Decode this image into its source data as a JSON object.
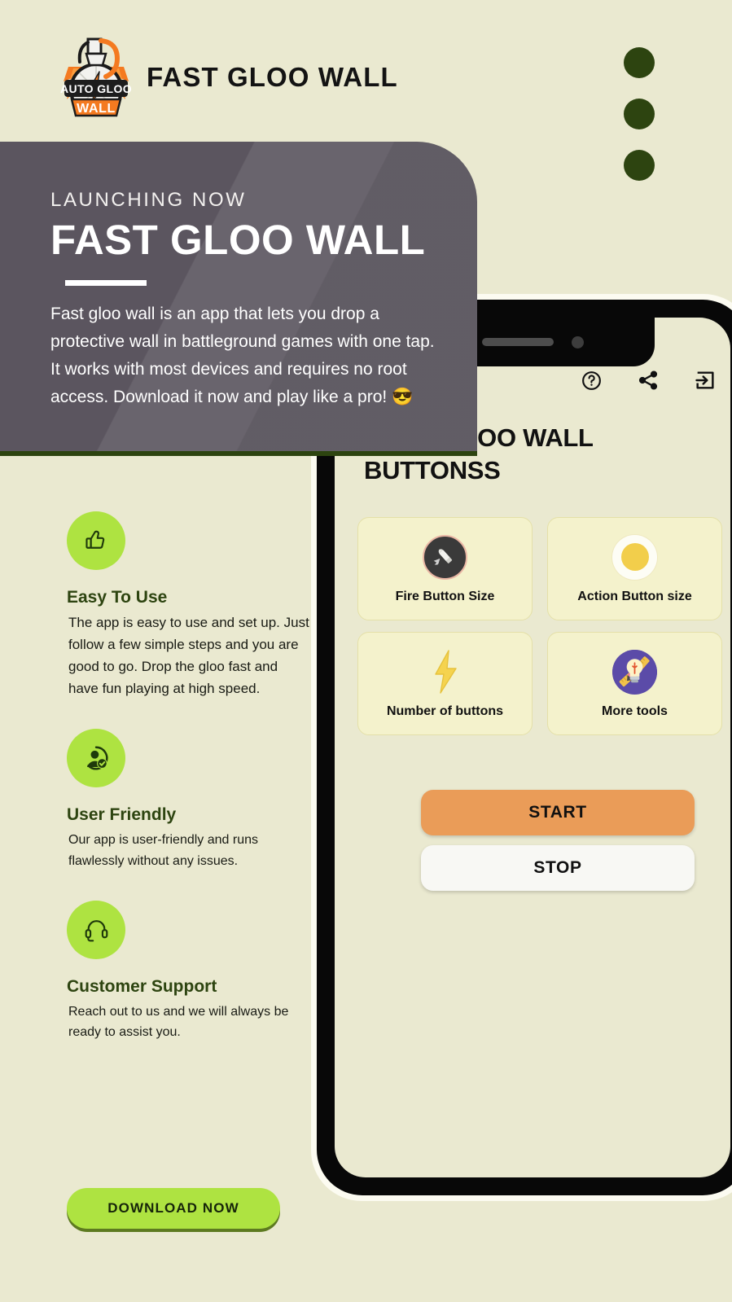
{
  "header": {
    "brand_title": "FAST GLOO WALL",
    "logo_top_text": "AUTO GLOO",
    "logo_bottom_text": "WALL",
    "menu_icon": "kebab-menu-icon",
    "menu_dots": 3
  },
  "promo": {
    "eyebrow": "LAUNCHING NOW",
    "title": "FAST GLOO WALL",
    "body": "Fast gloo wall is an app that lets you drop a protective wall in battleground games with one tap. It works with most devices and requires no root access. Download it now and play like a pro! 😎"
  },
  "features": [
    {
      "icon": "thumbs-up-icon",
      "title": "Easy To Use",
      "body": "The app is easy to use and set up. Just follow a few simple steps and you are good to go. Drop the gloo fast and have fun playing at high speed."
    },
    {
      "icon": "user-verified-icon",
      "title": "User Friendly",
      "body": "Our app is user-friendly and runs flawlessly without any issues."
    },
    {
      "icon": "headset-icon",
      "title": "Customer Support",
      "body": "Reach out to us and we will always be ready to assist you."
    }
  ],
  "download_button": {
    "label": "DOWNLOAD NOW"
  },
  "phone": {
    "app_heading": "YOUR GLOO WALL BUTTONSS",
    "toolbar": [
      {
        "icon": "help-circle-icon",
        "name": "help-button"
      },
      {
        "icon": "share-icon",
        "name": "share-button"
      },
      {
        "icon": "login-arrow-icon",
        "name": "login-button"
      }
    ],
    "grid": [
      {
        "label": "Fire Button Size",
        "icon": "bullet-icon"
      },
      {
        "label": "Action Button size",
        "icon": "yellow-circle-icon"
      },
      {
        "label": "Number of buttons",
        "icon": "lightning-bolt-icon"
      },
      {
        "label": "More tools",
        "icon": "tools-bulb-icon"
      }
    ],
    "start_label": "START",
    "stop_label": "STOP"
  },
  "colors": {
    "background": "#eae9d0",
    "accent_green": "#aee341",
    "dark_green": "#2d4410",
    "panel_gray": "#5b555f",
    "start_orange": "#ea9c58",
    "stop_white": "#f8f8f4",
    "logo_orange": "#f47a20"
  }
}
